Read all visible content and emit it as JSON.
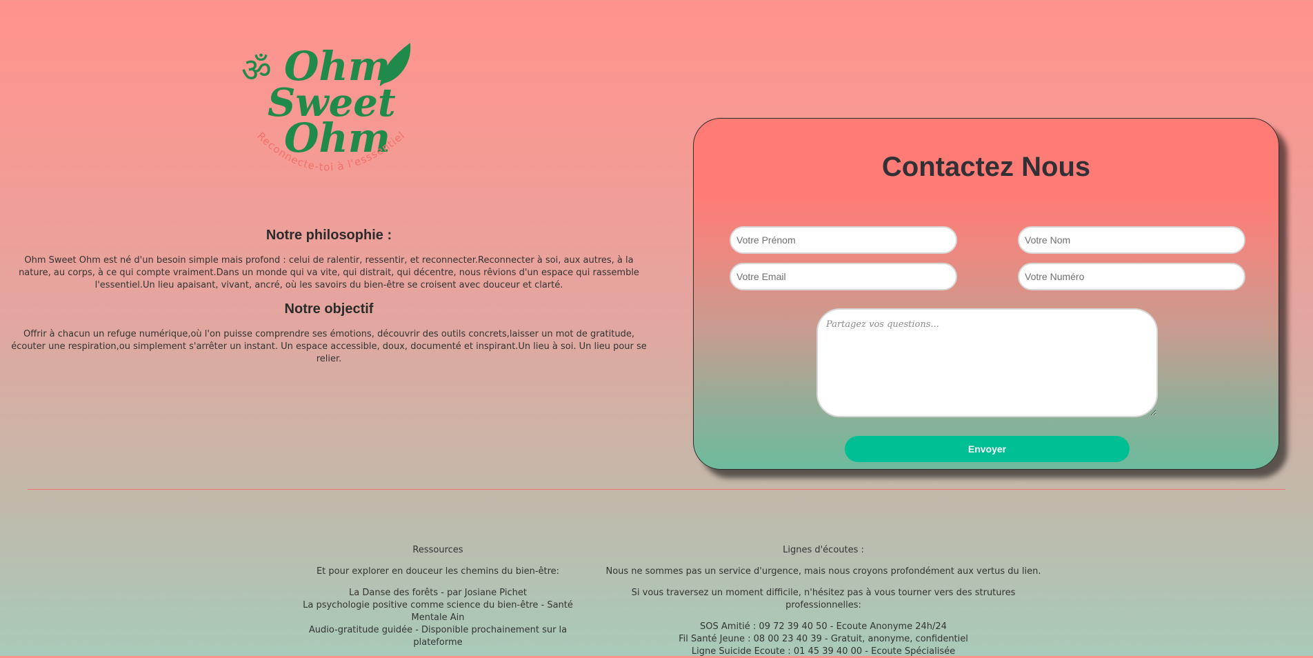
{
  "logo": {
    "name": "Ohm Sweet Ohm",
    "line1": "Ohm",
    "line2": "Sweet",
    "line3": "Ohm",
    "om_symbol": "ॐ",
    "tagline": "Reconnecte-toi à l'esssentiel",
    "green": "#1f8a4a",
    "tagline_color": "#f3706a"
  },
  "about": {
    "philosophy_title": "Notre philosophie :",
    "philosophy_text": "Ohm Sweet Ohm est né d'un besoin simple mais profond : celui de ralentir, ressentir, et reconnecter.Reconnecter à soi, aux autres, à la nature, au corps, à ce qui compte vraiment.Dans un monde qui va vite, qui distrait, qui décentre, nous rêvions d'un espace qui rassemble l'essentiel.Un lieu apaisant, vivant, ancré, où les savoirs du bien-être se croisent avec douceur et clarté.",
    "objective_title": "Notre objectif",
    "objective_text": "Offrir à chacun un refuge numérique,où l'on puisse comprendre ses émotions, découvrir des outils concrets,laisser un mot de gratitude, écouter une respiration,ou simplement s'arrêter un instant. Un espace accessible, doux, documenté et inspirant.Un lieu à soi. Un lieu pour se relier."
  },
  "contact": {
    "title": "Contactez Nous",
    "firstname_placeholder": "Votre Prénom",
    "lastname_placeholder": "Votre Nom",
    "email_placeholder": "Votre Email",
    "phone_placeholder": "Votre Numéro",
    "message_placeholder": "Partagez vos questions...",
    "submit_label": "Envoyer",
    "button_color": "#00bf94"
  },
  "footer": {
    "resources": {
      "title": "Ressources",
      "intro": "Et pour explorer en douceur les chemins du bien-être:",
      "items": [
        "La Danse des forêts - par Josiane Pichet",
        "La psychologie positive comme science du bien-être - Santé Mentale Ain",
        "Audio-gratitude guidée - Disponible prochainement sur la plateforme"
      ]
    },
    "hotlines": {
      "title": "Lignes d'écoutes :",
      "intro": "Nous ne sommes pas un service d'urgence, mais nous croyons profondément aux vertus du lien.",
      "advice": "Si vous traversez un moment difficile, n'hésitez pas à vous tourner vers des strutures professionnelles:",
      "items": [
        "SOS Amitié : 09 72 39 40 50 - Ecoute Anonyme 24h/24",
        "Fil Santé Jeune : 08 00 23 40 39 - Gratuit, anonyme, confidentiel",
        "Ligne Suicide Ecoute : 01 45 39 40 00 - Ecoute Spécialisée"
      ]
    }
  }
}
